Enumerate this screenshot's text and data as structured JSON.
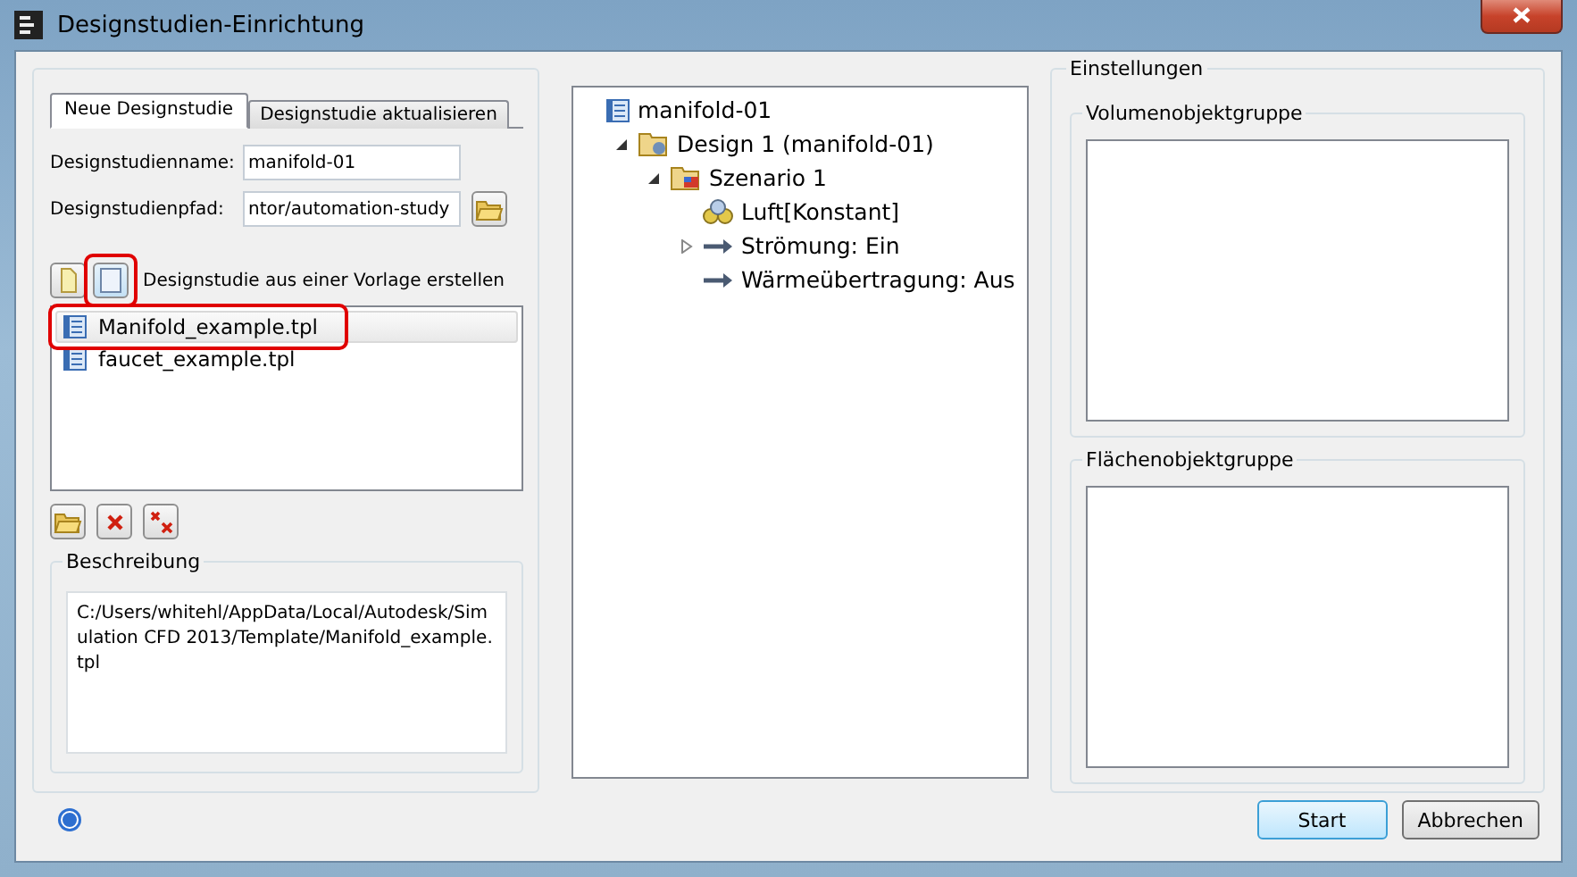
{
  "window": {
    "title": "Designstudien-Einrichtung"
  },
  "tabs": [
    {
      "label": "Neue Designstudie",
      "selected": true
    },
    {
      "label": "Designstudie aktualisieren",
      "selected": false
    }
  ],
  "name_field": {
    "label": "Designstudienname:",
    "value": "manifold-01"
  },
  "path_field": {
    "label": "Designstudienpfad:",
    "value": "ntor/automation-study"
  },
  "source_buttons": [
    {
      "kind": "blank",
      "selected": false,
      "highlighted": false
    },
    {
      "kind": "template",
      "selected": true,
      "highlighted": true
    }
  ],
  "source_label": "Designstudie aus einer Vorlage erstellen",
  "templates": [
    {
      "label": "Manifold_example.tpl",
      "selected": true,
      "highlighted": true
    },
    {
      "label": "faucet_example.tpl",
      "selected": false,
      "highlighted": false
    }
  ],
  "list_buttons": [
    {
      "kind": "open"
    },
    {
      "kind": "delete"
    },
    {
      "kind": "delete-all"
    }
  ],
  "description": {
    "title": "Beschreibung",
    "text": "C:/Users/whitehl/AppData/Local/Autodesk/Simulation CFD 2013/Template/Manifold_example.tpl"
  },
  "tree": [
    {
      "label": "manifold-01",
      "kind": "study",
      "children": [
        {
          "label": "Design 1 (manifold-01)",
          "kind": "design",
          "expanded": true,
          "children": [
            {
              "label": "Szenario 1",
              "kind": "scenario",
              "expanded": true,
              "children": [
                {
                  "label": "Luft[Konstant]",
                  "kind": "material"
                },
                {
                  "label": "Strömung: Ein",
                  "kind": "arrow",
                  "expanded": false
                },
                {
                  "label": "Wärmeübertragung: Aus",
                  "kind": "arrow"
                }
              ]
            }
          ]
        }
      ]
    }
  ],
  "settings": {
    "title": "Einstellungen",
    "groups": [
      "Volumenobjektgruppe",
      "Flächenobjektgruppe"
    ]
  },
  "buttons": [
    {
      "label": "Start",
      "default": true
    },
    {
      "label": "Abbrechen",
      "default": false
    }
  ]
}
